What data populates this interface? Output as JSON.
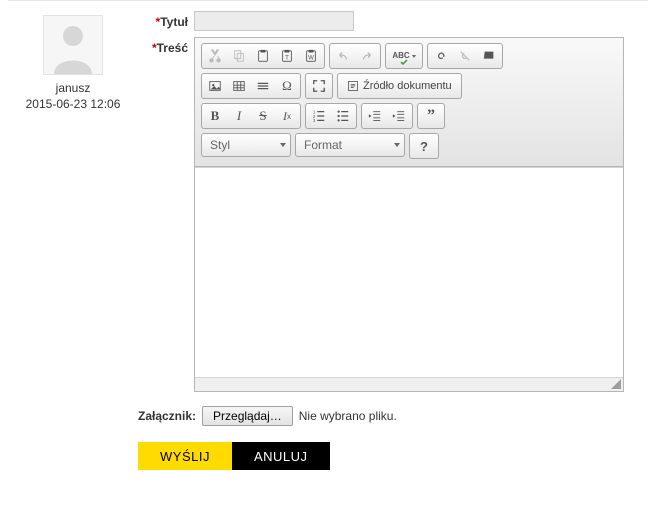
{
  "user": {
    "name": "janusz",
    "timestamp": "2015-06-23 12:06"
  },
  "form": {
    "title_label": "Tytuł",
    "title_value": "",
    "content_label": "Treść",
    "required_marker": "*"
  },
  "editor": {
    "source_button": "Źródło dokumentu",
    "style_combo": "Styl",
    "format_combo": "Format",
    "help_symbol": "?",
    "spellcheck_label": "ABC"
  },
  "attachment": {
    "label": "Załącznik:",
    "browse_button": "Przeglądaj…",
    "status": "Nie wybrano pliku."
  },
  "actions": {
    "send": "WYŚLIJ",
    "cancel": "ANULUJ"
  }
}
